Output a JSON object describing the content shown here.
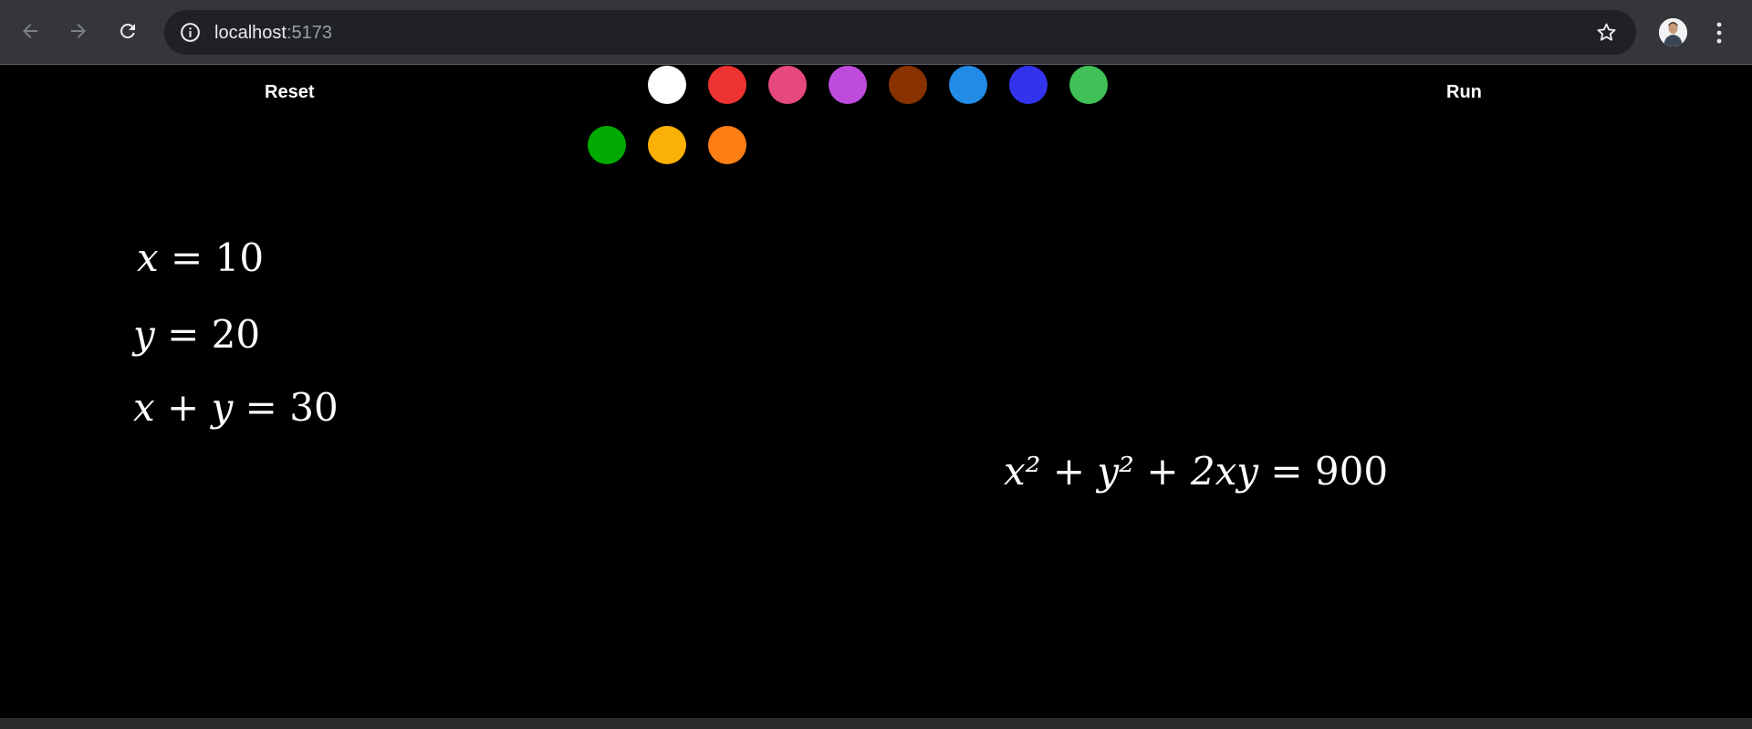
{
  "browser": {
    "url_host": "localhost",
    "url_port": ":5173",
    "icons": {
      "back": "arrow-left-icon",
      "forward": "arrow-right-icon",
      "reload": "reload-icon",
      "site_info": "info-icon",
      "bookmark": "star-icon",
      "profile": "avatar",
      "menu": "kebab-menu-icon"
    }
  },
  "toolbar": {
    "reset_label": "Reset",
    "run_label": "Run"
  },
  "palette": {
    "colors": [
      "#000000",
      "#ffffff",
      "#ee3333",
      "#e64980",
      "#be4bdb",
      "#893200",
      "#228be6",
      "#3333ee",
      "#40c057",
      "#00aa00",
      "#fab005",
      "#fd7e14"
    ]
  },
  "canvas": {
    "expressions": [
      {
        "lhs": "x",
        "rhs": "10"
      },
      {
        "lhs": "y",
        "rhs": "20"
      },
      {
        "lhs": "x + y",
        "rhs": "30"
      },
      {
        "lhs": "x² + y² + 2xy",
        "rhs": "900"
      }
    ]
  }
}
